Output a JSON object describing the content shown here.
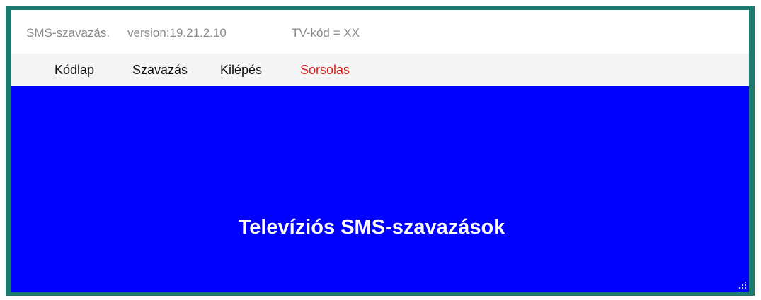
{
  "window": {
    "title_app": "SMS-szavazás.",
    "title_version": "version:19.21.2.10",
    "title_tv_code": "TV-kód = XX"
  },
  "menu": {
    "items": [
      {
        "label": "Kódlap",
        "color": "#111111"
      },
      {
        "label": "Szavazás",
        "color": "#111111"
      },
      {
        "label": "Kilépés",
        "color": "#111111"
      },
      {
        "label": "Sorsolas",
        "color": "#e02020"
      }
    ]
  },
  "main": {
    "heading": "Televíziós SMS-szavazások",
    "background_color": "#0000ff"
  },
  "colors": {
    "frame": "#1d7a6e",
    "accent_menu": "#e02020"
  },
  "icons": {
    "resize_grip": "resize-grip-icon"
  }
}
